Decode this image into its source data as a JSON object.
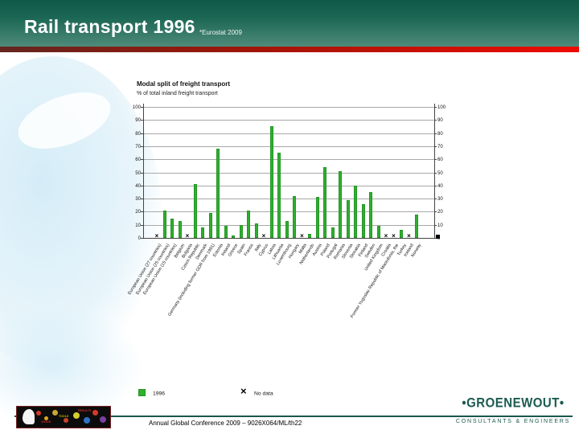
{
  "header": {
    "title": "Rail transport 1996",
    "source_note": "*Eurostat 2009"
  },
  "chart_data": {
    "type": "bar",
    "title": "Modal split of freight transport",
    "subtitle": "% of total inland freight transport",
    "ylabel": "%",
    "ylim": [
      0,
      100
    ],
    "ytick_step": 10,
    "grid": true,
    "legend_position": "bottom",
    "bar_color": "#2fae2f",
    "no_data_marker": "×",
    "categories": [
      "European Union (27 countries)",
      "European Union (25 countries)",
      "European Union (15 countries)",
      "Belgium",
      "Bulgaria",
      "Czech Republic",
      "Denmark",
      "Germany (including former GDR from 1991)",
      "Estonia",
      "Ireland",
      "Greece",
      "Spain",
      "France",
      "Italy",
      "Cyprus",
      "Latvia",
      "Lithuania",
      "Luxembourg",
      "Hungary",
      "Malta",
      "Netherlands",
      "Austria",
      "Poland",
      "Portugal",
      "Romania",
      "Slovenia",
      "Slovakia",
      "Finland",
      "Sweden",
      "United Kingdom",
      "Croatia",
      "Former Yugoslav Republic of Macedonia, the",
      "Turkey",
      "Iceland",
      "Norway"
    ],
    "values": [
      null,
      21,
      15,
      13,
      null,
      41,
      8,
      19,
      68,
      9,
      2,
      10,
      21,
      11,
      null,
      85,
      65,
      13,
      32,
      null,
      3,
      31,
      54,
      8,
      51,
      29,
      40,
      26,
      35,
      9,
      null,
      null,
      6,
      null,
      18
    ]
  },
  "legend": {
    "year_label": "1996",
    "no_data_label": "No data",
    "no_data_symbol": "×"
  },
  "footer": {
    "text": "Annual Global Conference 2009 – 9026X064/ML/th",
    "page_number": "22"
  },
  "branding": {
    "groenewout_name": "•GROENEWOUT•",
    "groenewout_tagline": "CONSULTANTS & ENGINEERS",
    "strip_labels": [
      "VISION",
      "TOOLS",
      "RESULTS"
    ]
  },
  "colors": {
    "header_green_top": "#0f5948",
    "header_green_bottom": "#4e8a79",
    "divider_red": "#ee0b00",
    "bar_green": "#2fae2f",
    "footer_teal": "#17584e",
    "logo_teal": "#1b5a50",
    "watermark_blue": "#d8eef8"
  }
}
